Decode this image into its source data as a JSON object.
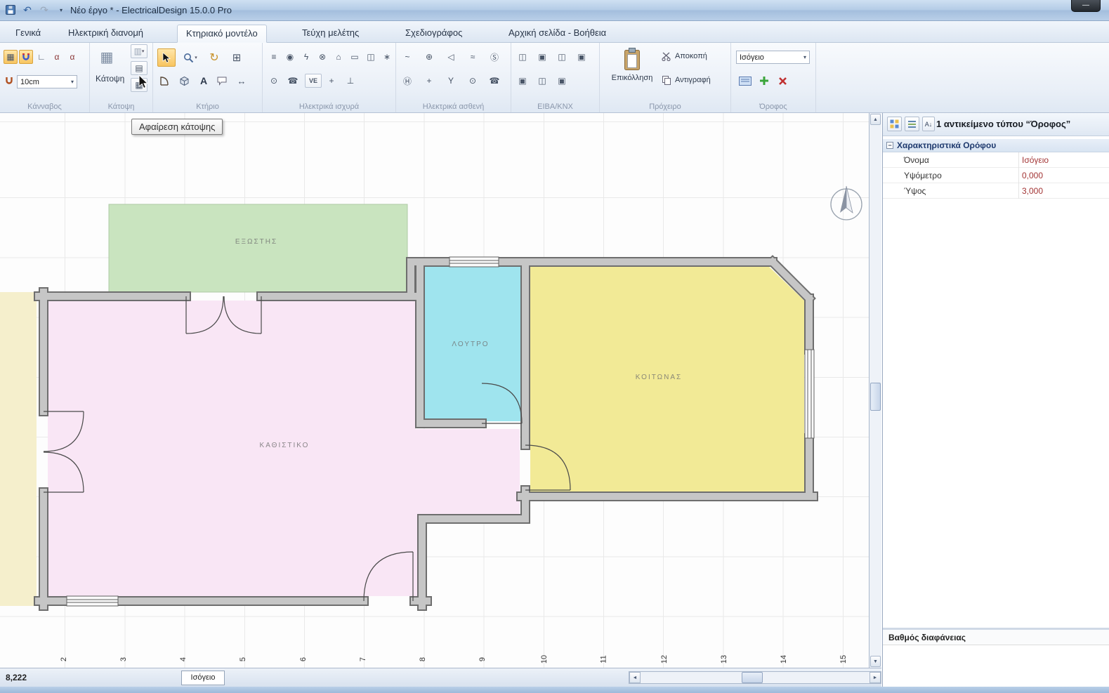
{
  "window": {
    "title": "Νέο έργο * - ElectricalDesign 15.0.0 Pro"
  },
  "menu_tabs": [
    "Γενικά",
    "Ηλεκτρική διανομή",
    "Κτηριακό μοντέλο",
    "Τεύχη μελέτης",
    "Σχεδιογράφος",
    "Αρχική σελίδα - Βοήθεια"
  ],
  "ribbon": {
    "grid": {
      "label": "Κάνναβος",
      "spacing": "10cm"
    },
    "floorplan": {
      "label": "Κάτοψη",
      "button": "Κάτοψη"
    },
    "building": {
      "label": "Κτήριο"
    },
    "power": {
      "label": "Ηλεκτρικά ισχυρά"
    },
    "weak": {
      "label": "Ηλεκτρικά ασθενή"
    },
    "knx": {
      "label": "ΕΙΒΑ/ΚΝΧ"
    },
    "clipboard": {
      "label": "Πρόχειρο",
      "paste": "Επικόλληση",
      "cut": "Αποκοπή",
      "copy": "Αντιγραφή"
    },
    "floor": {
      "label": "Όροφος",
      "selected": "Ισόγειο"
    }
  },
  "tooltip": "Αφαίρεση κάτοψης",
  "canvas": {
    "rooms": [
      "ΕΞΩΣΤΗΣ",
      "ΚΑΘΙΣΤΙΚΟ",
      "ΛΟΥΤΡΟ",
      "ΚΟΙΤΩΝΑΣ"
    ],
    "ruler": [
      "2",
      "3",
      "4",
      "5",
      "6",
      "7",
      "8",
      "9",
      "10",
      "11",
      "12",
      "13",
      "14",
      "15"
    ]
  },
  "properties": {
    "title": "1 αντικείμενο τύπου “Όροφος”",
    "section": "Χαρακτηριστικά Ορόφου",
    "rows": [
      {
        "label": "Όνομα",
        "value": "Ισόγειο"
      },
      {
        "label": "Υψόμετρο",
        "value": "0,000"
      },
      {
        "label": "Ύψος",
        "value": "3,000"
      }
    ],
    "opacity_section": "Βαθμός διαφάνειας"
  },
  "status": {
    "coords": "8,222",
    "floor": "Ισόγειο"
  },
  "colors": {
    "accent_orange": "#f8c561",
    "value_red": "#a33535",
    "room_pink": "#f9e6f5",
    "room_cyan": "#9fe4ee",
    "room_yellow": "#f2ea96",
    "room_green": "#c9e4bf",
    "left_strip_yellow": "#f5efcc",
    "wall_gray": "#c6c6c6"
  },
  "glyphs": {
    "caret": "▾",
    "up_arrow": "▲",
    "down_arrow": "▼",
    "left_arrow": "◄",
    "right_arrow": "►",
    "grid_toggle": "▦",
    "corner_snap": "∟",
    "alpha_snap": "α",
    "alpha_snap2": "α",
    "plan_icon": "▦",
    "plan_small_1": "▥",
    "plan_small_2": "▤",
    "plan_small_3": "▦",
    "rotate_tool": "↻",
    "keypad_tool": "⊞",
    "text_tool": "A",
    "dimension_tool": "↔",
    "power_1": "≡",
    "power_2": "◉",
    "power_3": "ϟ",
    "power_4": "⊗",
    "power_5": "⌂",
    "power_6": "▭",
    "power_7": "◫",
    "power_8": "∗",
    "power_9": "⊙",
    "power_10": "☎",
    "power_11": "VE",
    "power_12": "+",
    "power_13": "⊥",
    "weak_1": "~",
    "weak_2": "⊕",
    "weak_3": "◁",
    "weak_4": "≈",
    "weak_5": "Ⓢ",
    "weak_6": "Ⓗ",
    "weak_7": "+",
    "weak_8": "Y",
    "weak_9": "⊙",
    "weak_10": "☎",
    "knx_1": "◫",
    "knx_2": "▣",
    "knx_3": "◫",
    "knx_4": "▣",
    "knx_5": "▣",
    "knx_6": "◫",
    "knx_7": "▣",
    "sort_az": "A↓",
    "minimize": "—",
    "undo": "↶",
    "redo": "↷",
    "minus": "−"
  }
}
